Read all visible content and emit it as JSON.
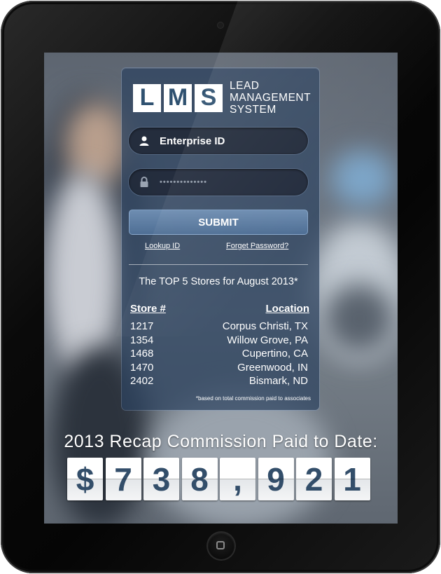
{
  "logo": {
    "letters": [
      "L",
      "M",
      "S"
    ],
    "line1": "LEAD",
    "line2": "MANAGEMENT",
    "line3": "SYSTEM"
  },
  "login": {
    "enterprise_id_value": "Enterprise ID",
    "password_value": "••••••••••••••",
    "submit_label": "SUBMIT",
    "lookup_link": "Lookup ID",
    "forgot_link": "Forget Password?"
  },
  "stores": {
    "title": "The TOP 5 Stores for August 2013*",
    "col_store": "Store #",
    "col_location": "Location",
    "rows": [
      {
        "store": "1217",
        "location": "Corpus Christi, TX"
      },
      {
        "store": "1354",
        "location": "Willow Grove, PA"
      },
      {
        "store": "1468",
        "location": "Cupertino, CA"
      },
      {
        "store": "1470",
        "location": "Greenwood, IN"
      },
      {
        "store": "2402",
        "location": "Bismark, ND"
      }
    ],
    "footnote": "*based on total commission paid to associates"
  },
  "recap": {
    "label": "2013 Recap Commission Paid to Date:",
    "digits": [
      "$",
      "7",
      "3",
      "8",
      ",",
      "9",
      "2",
      "1"
    ]
  },
  "colors": {
    "panel": "#2d4260",
    "submit": "#5f7ea4",
    "digit_text": "#334e6a"
  }
}
